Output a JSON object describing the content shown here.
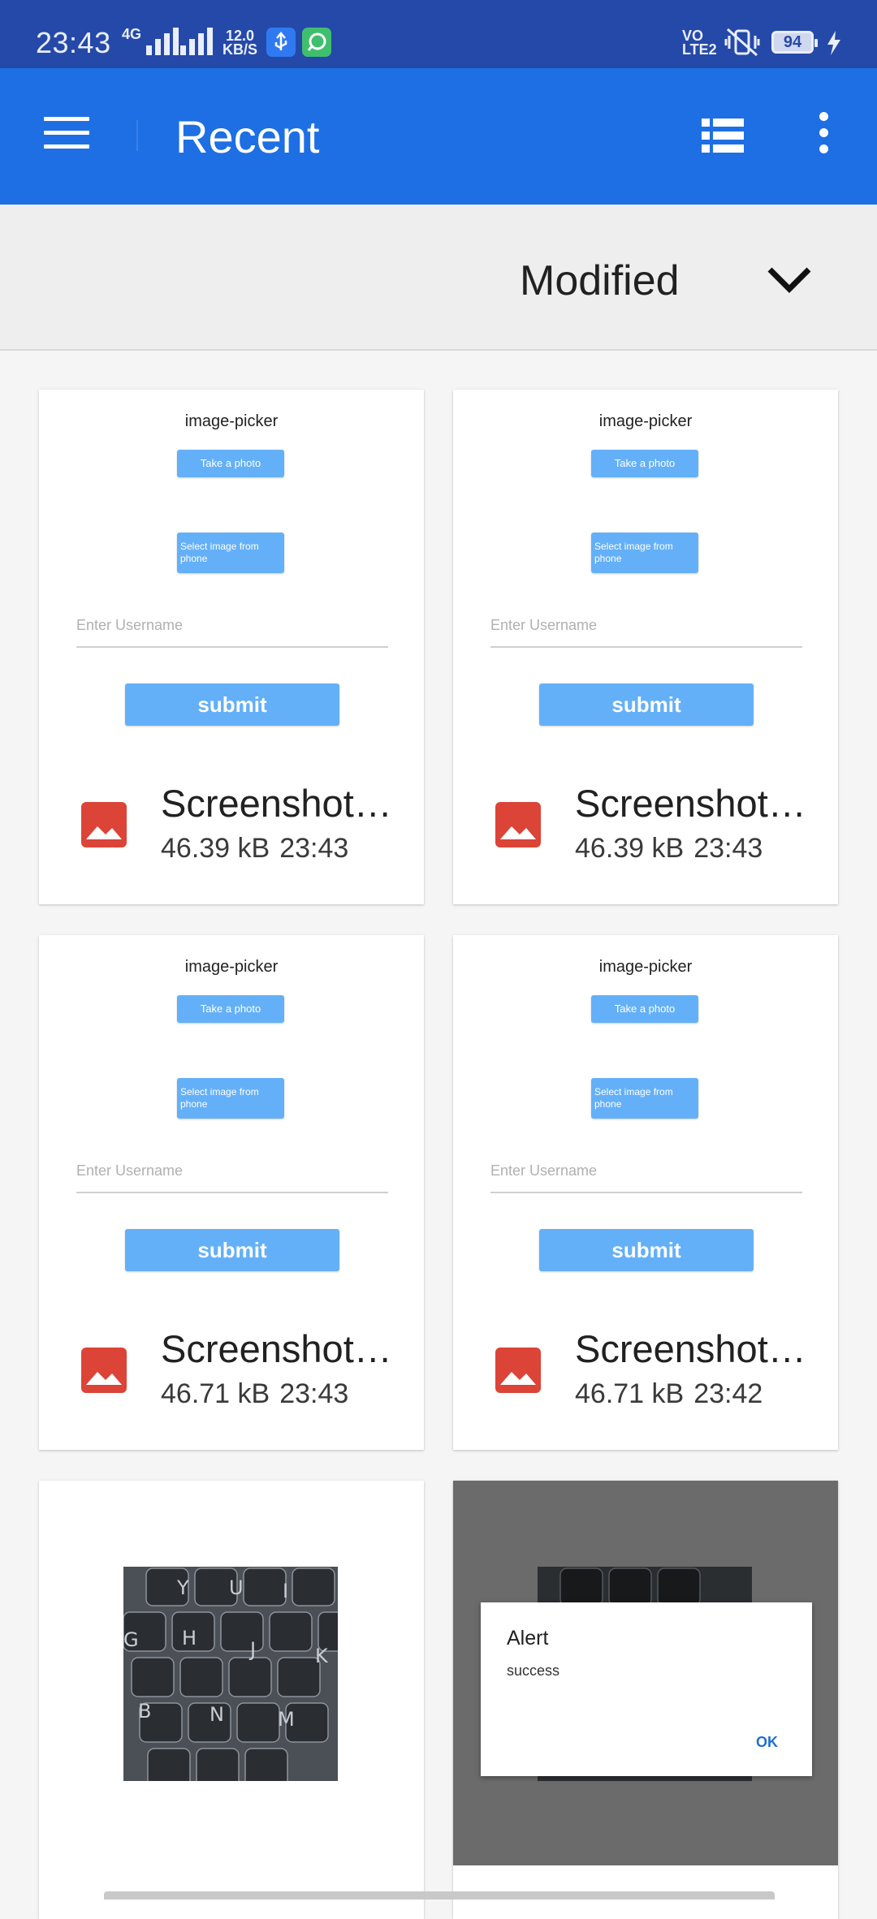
{
  "status_bar": {
    "time": "23:43",
    "network_gen": "4G",
    "speed_value": "12.0",
    "speed_unit": "KB/S",
    "volte_line1": "VO",
    "volte_line2": "LTE2",
    "battery": "94"
  },
  "app_bar": {
    "title": "Recent",
    "menu_icon": "hamburger-menu-icon",
    "view_icon": "list-view-icon",
    "more_icon": "more-vert-icon"
  },
  "sort": {
    "label": "Modified",
    "icon": "chevron-down-icon"
  },
  "thumbnail_content": {
    "title": "image-picker",
    "take_photo": "Take a photo",
    "select_image": "Select image from phone",
    "username_placeholder": "Enter Username",
    "submit": "submit"
  },
  "files": [
    {
      "name": "Screenshot…",
      "size": "46.39 kB",
      "time": "23:43"
    },
    {
      "name": "Screenshot…",
      "size": "46.39 kB",
      "time": "23:43"
    },
    {
      "name": "Screenshot…",
      "size": "46.71 kB",
      "time": "23:43"
    },
    {
      "name": "Screenshot…",
      "size": "46.71 kB",
      "time": "23:42"
    }
  ],
  "keyboard_keys": [
    "Y",
    "U",
    "I",
    "G",
    "H",
    "J",
    "K",
    "B",
    "N",
    "M"
  ],
  "alert": {
    "title": "Alert",
    "message": "success",
    "ok": "OK"
  },
  "colors": {
    "status_bar": "#2549a8",
    "app_bar": "#1e6fe4",
    "thumb_button": "#64b0f8",
    "image_icon": "#db4437",
    "alert_ok": "#1f6fcf"
  }
}
